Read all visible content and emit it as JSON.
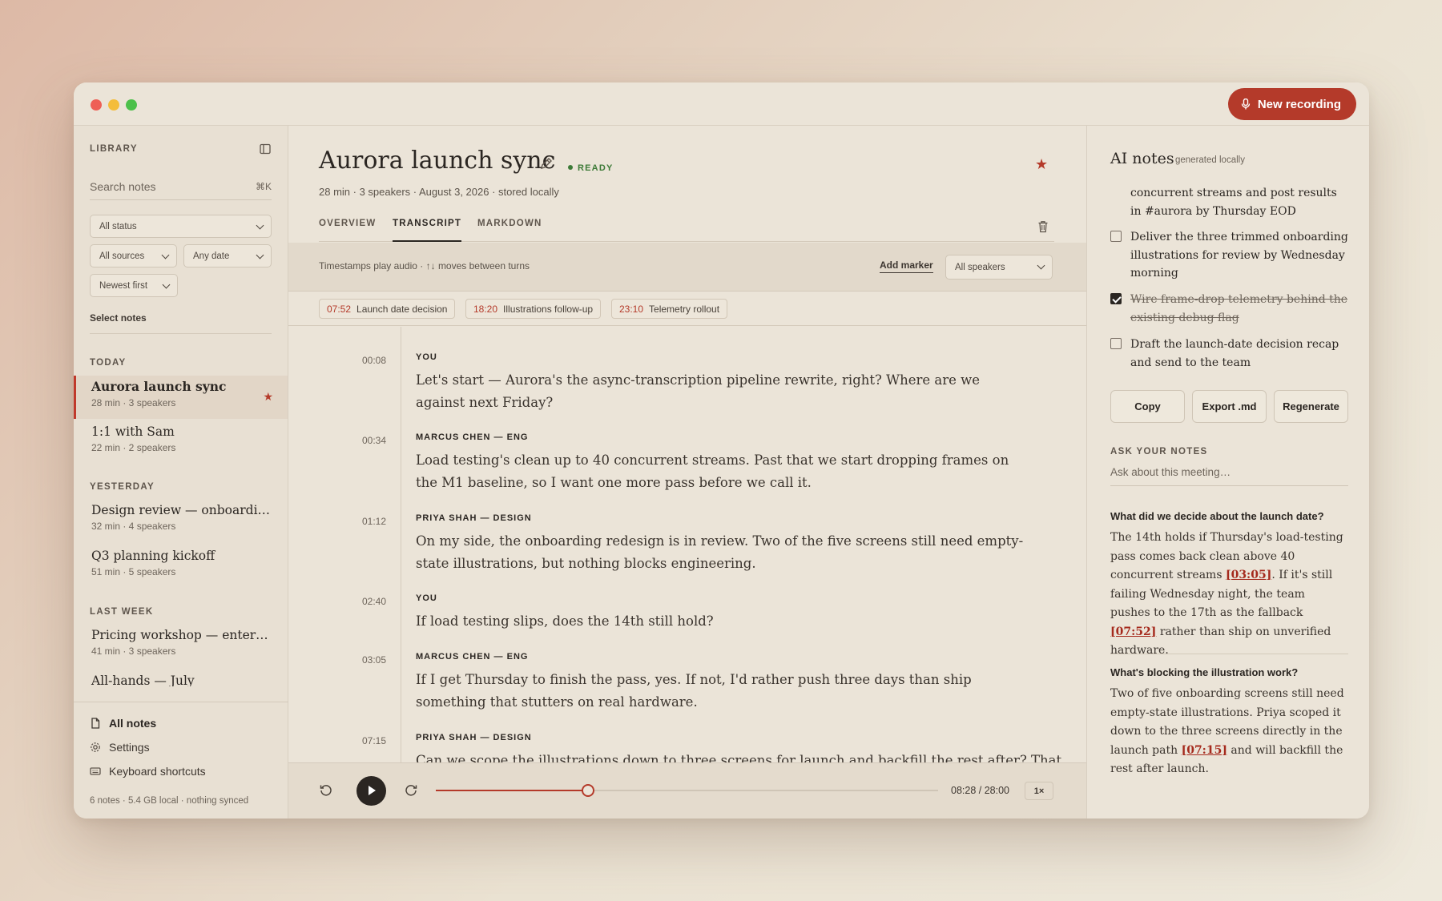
{
  "header": {
    "new_recording": "New recording"
  },
  "sidebar": {
    "library_label": "LIBRARY",
    "search_placeholder": "Search notes",
    "search_shortcut": "⌘K",
    "filters": {
      "status": "All status",
      "sources": "All sources",
      "date": "Any date",
      "sort": "Newest first"
    },
    "select_notes": "Select notes",
    "groups": {
      "today": "TODAY",
      "yesterday": "YESTERDAY",
      "last_week": "LAST WEEK"
    },
    "notes": [
      {
        "title": "Aurora launch sync",
        "meta": "28 min · 3 speakers"
      },
      {
        "title": "1:1 with Sam",
        "meta": "22 min · 2 speakers"
      },
      {
        "title": "Design review — onboardi…",
        "meta": "32 min · 4 speakers"
      },
      {
        "title": "Q3 planning kickoff",
        "meta": "51 min · 5 speakers"
      },
      {
        "title": "Pricing workshop — enter…",
        "meta": "41 min · 3 speakers"
      },
      {
        "title": "All-hands — July",
        "meta": ""
      }
    ],
    "footer": {
      "all_notes": "All notes",
      "settings": "Settings",
      "shortcuts": "Keyboard shortcuts"
    },
    "storage": "6 notes · 5.4 GB local · nothing synced"
  },
  "main": {
    "title": "Aurora launch sync",
    "status": "READY",
    "meta": "28 min · 3 speakers · August 3, 2026 · stored locally",
    "tabs": [
      "OVERVIEW",
      "TRANSCRIPT",
      "MARKDOWN"
    ],
    "hint": "Timestamps play audio · ↑↓ moves between turns",
    "add_marker": "Add marker",
    "speaker_filter": "All speakers",
    "markers": [
      {
        "time": "07:52",
        "label": "Launch date decision"
      },
      {
        "time": "18:20",
        "label": "Illustrations follow-up"
      },
      {
        "time": "23:10",
        "label": "Telemetry rollout"
      }
    ],
    "turns": [
      {
        "time": "00:08",
        "speaker": "YOU",
        "text": "Let's start — Aurora's the async-transcription pipeline rewrite, right? Where are we against next Friday?"
      },
      {
        "time": "00:34",
        "speaker": "MARCUS CHEN — ENG",
        "text": "Load testing's clean up to 40 concurrent streams. Past that we start dropping frames on the M1 baseline, so I want one more pass before we call it."
      },
      {
        "time": "01:12",
        "speaker": "PRIYA SHAH — DESIGN",
        "text": "On my side, the onboarding redesign is in review. Two of the five screens still need empty-state illustrations, but nothing blocks engineering."
      },
      {
        "time": "02:40",
        "speaker": "YOU",
        "text": "If load testing slips, does the 14th still hold?"
      },
      {
        "time": "03:05",
        "speaker": "MARCUS CHEN — ENG",
        "text": "If I get Thursday to finish the pass, yes. If not, I'd rather push three days than ship something that stutters on real hardware."
      },
      {
        "time": "07:15",
        "speaker": "PRIYA SHAH — DESIGN",
        "text": "Can we scope the illustrations down to three screens for launch and backfill the rest after? That"
      }
    ],
    "player": {
      "time": "08:28 / 28:00",
      "progress": 0.3024,
      "speed": "1×"
    }
  },
  "ai": {
    "title": "AI notes",
    "subtitle": "generated locally",
    "tasks": [
      {
        "text": "concurrent streams and post results in #aurora by Thursday EOD",
        "checked": false,
        "partial": true
      },
      {
        "text": "Deliver the three trimmed onboarding illustrations for review by Wednesday morning",
        "checked": false
      },
      {
        "text": "Wire frame-drop telemetry behind the existing debug flag",
        "checked": true
      },
      {
        "text": "Draft the launch-date decision recap and send to the team",
        "checked": false
      }
    ],
    "buttons": {
      "copy": "Copy",
      "export": "Export .md",
      "regenerate": "Regenerate"
    },
    "ask_label": "ASK YOUR NOTES",
    "ask_placeholder": "Ask about this meeting…",
    "qa": [
      {
        "q": "What did we decide about the launch date?",
        "a_parts": [
          "The 14th holds if Thursday's load-testing pass comes back clean above 40 concurrent streams ",
          "[03:05]",
          ". If it's still failing Wednesday night, the team pushes to the 17th as the fallback ",
          "[07:52]",
          " rather than ship on unverified hardware."
        ]
      },
      {
        "q": "What's blocking the illustration work?",
        "a_parts": [
          "Two of five onboarding screens still need empty-state illustrations. Priya scoped it down to the three screens directly in the launch path ",
          "[07:15]",
          " and will backfill the rest after launch."
        ]
      }
    ]
  },
  "colors": {
    "accent": "#b43a2a",
    "ready": "#3d7a37",
    "background": "#ebe4d8"
  },
  "icons": [
    "sidebar-toggle-icon",
    "microphone-icon",
    "pencil-icon",
    "star-icon",
    "trash-icon",
    "document-icon",
    "gear-icon",
    "keyboard-icon",
    "rewind-icon",
    "play-icon",
    "forward-icon"
  ]
}
